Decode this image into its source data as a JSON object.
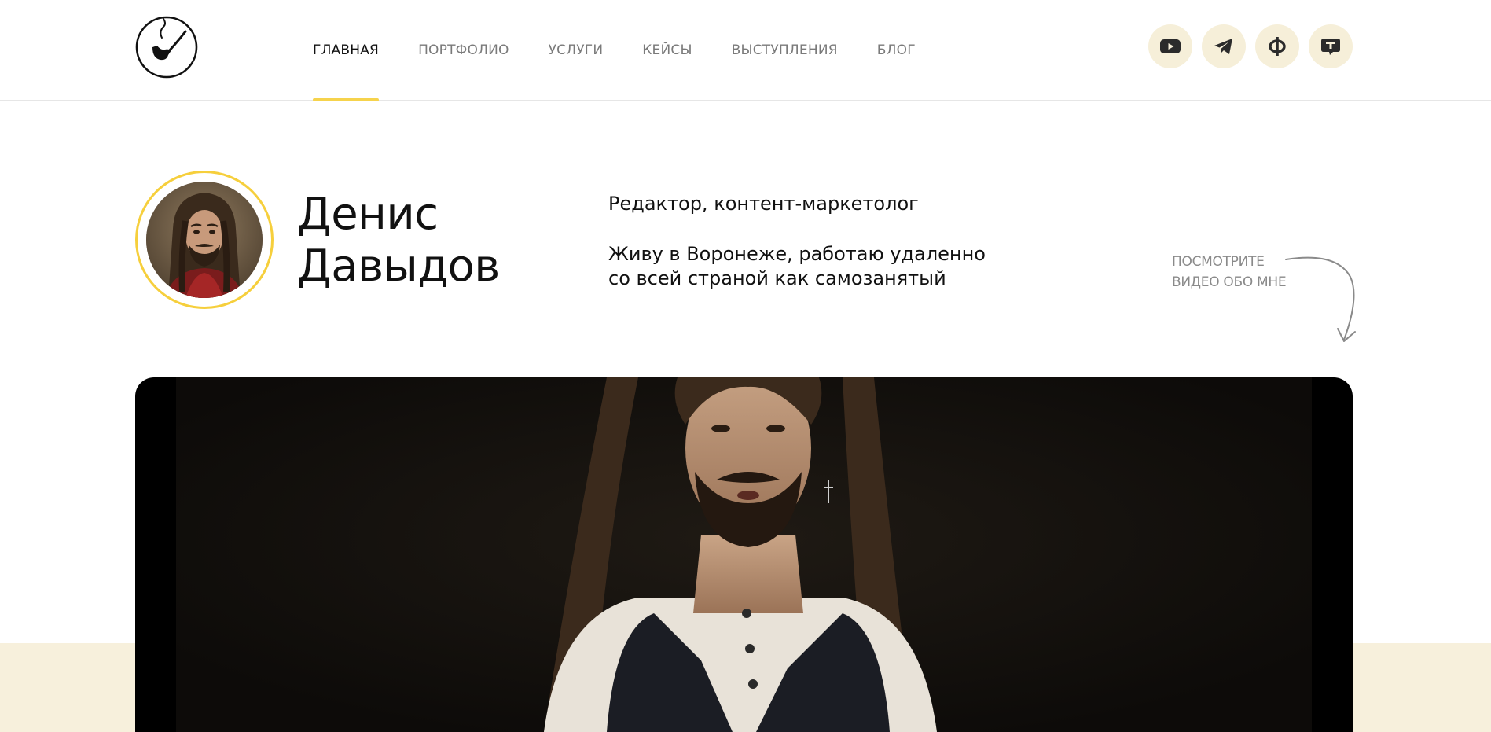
{
  "header": {
    "logo_icon": "pipe-checkmark-logo",
    "nav": [
      {
        "label": "ГЛАВНАЯ",
        "active": true
      },
      {
        "label": "ПОРТФОЛИО",
        "active": false
      },
      {
        "label": "УСЛУГИ",
        "active": false
      },
      {
        "label": "КЕЙСЫ",
        "active": false
      },
      {
        "label": "ВЫСТУПЛЕНИЯ",
        "active": false
      },
      {
        "label": "БЛОГ",
        "active": false
      }
    ],
    "socials": [
      {
        "icon": "youtube-icon"
      },
      {
        "icon": "telegram-icon"
      },
      {
        "icon": "facebook-icon"
      },
      {
        "icon": "tenchat-icon"
      }
    ]
  },
  "hero": {
    "name_first": "Денис",
    "name_last": "Давыдов",
    "role": "Редактор, контент-маркетолог",
    "location_line1": "Живу в Воронеже, работаю удаленно",
    "location_line2": "со всей страной как самозанятый",
    "video_hint_line1": "ПОСМОТРИТЕ",
    "video_hint_line2": "ВИДЕО ОБО МНЕ"
  },
  "colors": {
    "accent_yellow": "#f6d34c",
    "social_bg": "#f6efd9",
    "beige_band": "#f7f0dc",
    "nav_inactive": "#7a7a7a",
    "text": "#111111"
  }
}
